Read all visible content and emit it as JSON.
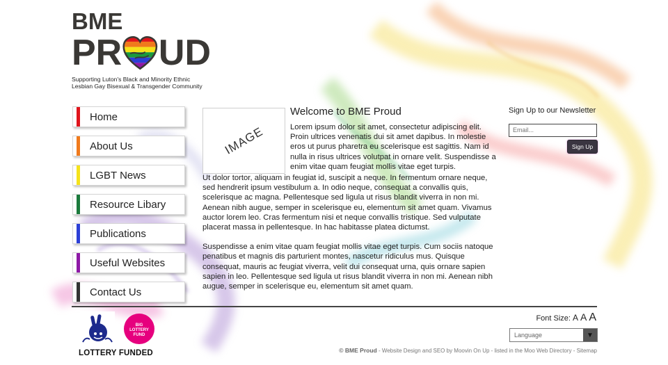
{
  "logo": {
    "line1": "BME",
    "line2a": "PR",
    "line2b": "UD",
    "tagline1": "Supporting Luton's Black and Minority Ethnic",
    "tagline2": "Lesbian Gay Bisexual & Transgender Community"
  },
  "nav": {
    "items": [
      {
        "label": "Home",
        "color": "#e0141c"
      },
      {
        "label": "About Us",
        "color": "#f07a1c"
      },
      {
        "label": "LGBT News",
        "color": "#f5e21a"
      },
      {
        "label": "Resource Libary",
        "color": "#1b7a3c"
      },
      {
        "label": "Publications",
        "color": "#2c3fd6"
      },
      {
        "label": "Useful Websites",
        "color": "#8e19a6"
      },
      {
        "label": "Contact Us",
        "color": "#333333"
      }
    ]
  },
  "main": {
    "image_placeholder": "IMAGE",
    "heading": "Welcome to BME Proud",
    "p1": "Lorem ipsum dolor sit amet, consectetur adipiscing elit. Proin ultrices venenatis dui sit amet dapibus. In molestie eros ut purus pharetra eu scelerisque est sagittis. Nam id nulla in risus ultrices volutpat in ornare velit. Suspendisse a enim vitae quam feugiat mollis vitae eget turpis.",
    "p2": "Ut dolor tortor, aliquam in feugiat id, suscipit a neque. In fermentum ornare neque, sed hendrerit ipsum vestibulum a. In odio neque, consequat a convallis quis, scelerisque ac magna. Pellentesque sed ligula ut risus blandit viverra in non mi. Aenean nibh augue, semper in scelerisque eu, elementum sit amet quam. Vivamus auctor lorem leo. Cras fermentum nisi et neque convallis tristique. Sed vulputate placerat massa in pellentesque. In hac habitasse platea dictumst.",
    "p3": "Suspendisse a enim vitae quam feugiat mollis vitae eget turpis. Cum sociis natoque penatibus et magnis dis parturient montes, nascetur ridiculus mus. Quisque consequat, mauris ac feugiat viverra, velit dui consequat urna, quis ornare sapien sapien in leo. Pellentesque sed ligula ut risus blandit viverra in non mi. Aenean nibh augue, semper in scelerisque eu, elementum sit amet quam."
  },
  "newsletter": {
    "title": "Sign Up to our Newsletter",
    "email_placeholder": "Email...",
    "button": "Sign Up"
  },
  "footer": {
    "lottery_caption": "LOTTERY FUNDED",
    "big_lottery_text": "BIG LOTTERY FUND",
    "font_size_label": "Font Size:",
    "font_a": "A",
    "language": "Language",
    "copyright": "© BME Proud",
    "credits": " - Website Design and SEO by Moovin On Up - listed in the Moo Web Directory - Sitemap"
  },
  "colors": {
    "pink": "#e6007e",
    "lottery_blue": "#1d2a8c",
    "text": "#222222"
  }
}
